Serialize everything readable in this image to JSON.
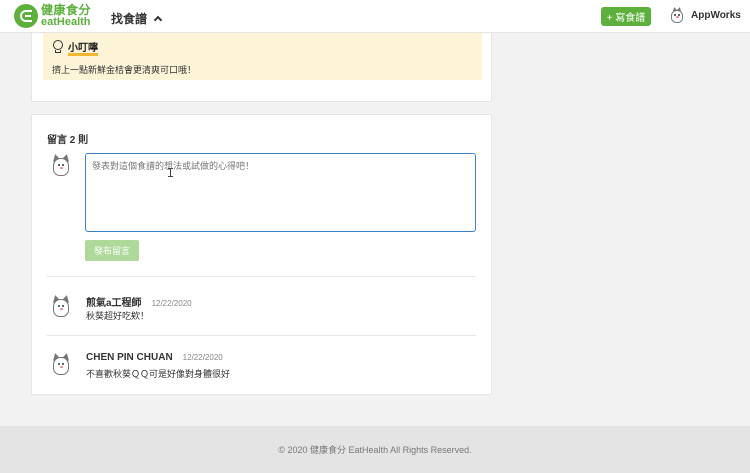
{
  "header": {
    "logo_cn": "健康食分",
    "logo_en": "eatHealth",
    "nav_recipes": "找食譜",
    "write_button": "+ 寫食譜",
    "user_name": "AppWorks"
  },
  "tip": {
    "title": "小叮嚀",
    "text": "擠上一點新鮮金桔會更清爽可口哦！"
  },
  "comments": {
    "header": "留言 2 則",
    "input_placeholder": "發表對這個食譜的想法或試做的心得吧！",
    "post_button": "發布留言",
    "items": [
      {
        "author": "煎氣a工程師",
        "date": "12/22/2020",
        "text": "秋葵超好吃欸！"
      },
      {
        "author": "CHEN PIN CHUAN",
        "date": "12/22/2020",
        "text": "不喜歡秋葵ＱＱ可是好像對身體很好"
      }
    ]
  },
  "footer": {
    "copyright": "© 2020 健康食分 EatHealth All Rights Reserved."
  },
  "colors": {
    "brand_green": "#5cb03b",
    "tip_background": "#fdf3d7",
    "input_focus_border": "#3e7fce",
    "disabled_button": "#aed99b"
  }
}
